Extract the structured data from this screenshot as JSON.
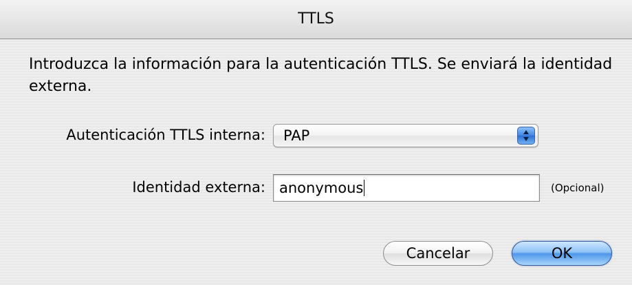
{
  "window": {
    "title": "TTLS"
  },
  "dialog": {
    "message": "Introduzca la información para la autenticación TTLS. Se enviará la identidad externa.",
    "inner_auth": {
      "label": "Autenticación TTLS interna:",
      "selected": "PAP"
    },
    "outer_identity": {
      "label": "Identidad externa:",
      "value": "anonymous",
      "hint": "(Opcional)"
    },
    "buttons": {
      "cancel": "Cancelar",
      "ok": "OK"
    }
  },
  "colors": {
    "default_button": "#4f96ea",
    "popup_stepper": "#3f86e3"
  },
  "icons": {
    "popup": "up-down-arrows-icon"
  }
}
